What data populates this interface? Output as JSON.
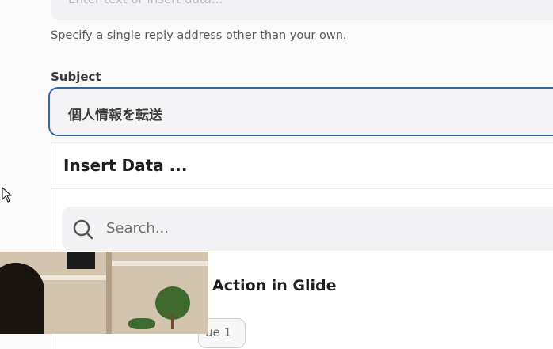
{
  "reply_to": {
    "placeholder": "Enter text or insert data...",
    "helper_text": "Specify a single reply address other than your own."
  },
  "subject": {
    "label": "Subject",
    "value": "個人情報を転送"
  },
  "insert_data_panel": {
    "title": "Insert Data ...",
    "search_placeholder": "Search...",
    "step_title": "Action in Glide",
    "pill_text": "ue 1"
  },
  "icons": {
    "search": "search-icon",
    "cursor": "mouse-cursor-icon"
  },
  "colors": {
    "focus_border": "#3567a8",
    "field_bg": "#f3f3f6"
  }
}
